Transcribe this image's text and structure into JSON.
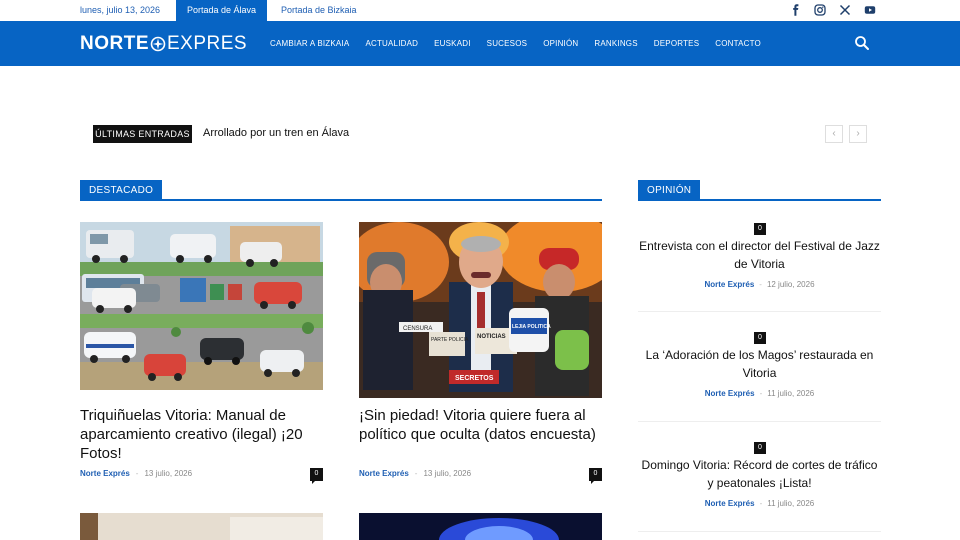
{
  "topbar": {
    "date": "lunes, julio 13, 2026",
    "tabs": [
      {
        "label": "Portada de Álava",
        "active": true
      },
      {
        "label": "Portada de Bizkaia",
        "active": false
      }
    ],
    "social_icons": [
      "facebook-icon",
      "instagram-icon",
      "x-icon",
      "youtube-icon"
    ]
  },
  "header": {
    "logo_bold": "NORTE",
    "logo_light": "EXPRES",
    "nav": [
      "CAMBIAR A BIZKAIA",
      "ACTUALIDAD",
      "EUSKADI",
      "SUCESOS",
      "OPINIÓN",
      "RANKINGS",
      "DEPORTES",
      "CONTACTO"
    ],
    "search_icon": "search-icon"
  },
  "ticker": {
    "label": "ÚLTIMAS ENTRADAS",
    "headline": "Arrollado por un tren en Álava",
    "prev": "‹",
    "next": "›"
  },
  "featured": {
    "heading": "DESTACADO",
    "articles": [
      {
        "title": "Triquiñuelas Vitoria: Manual de aparcamiento creativo (ilegal) ¡20 Fotos!",
        "author": "Norte Exprés",
        "sep": "-",
        "date": "13 julio, 2026",
        "comments": "0"
      },
      {
        "title": "¡Sin piedad! Vitoria quiere fuera al político que oculta (datos encuesta)",
        "author": "Norte Exprés",
        "sep": "-",
        "date": "13 julio, 2026",
        "comments": "0",
        "image_labels": [
          "CENSURA",
          "PARTE POLICIA",
          "NOTICIAS",
          "LEJIA POLITICA",
          "SECRETOS"
        ]
      }
    ]
  },
  "opinion": {
    "heading": "OPINIÓN",
    "items": [
      {
        "comments": "0",
        "title": "Entrevista con el director del Festival de Jazz de Vitoria",
        "author": "Norte Exprés",
        "sep": "-",
        "date": "12 julio, 2026"
      },
      {
        "comments": "0",
        "title": "La ‘Adoración de los Magos’ restaurada en Vitoria",
        "author": "Norte Exprés",
        "sep": "-",
        "date": "11 julio, 2026"
      },
      {
        "comments": "0",
        "title": "Domingo Vitoria: Récord de cortes de tráfico y peatonales ¡Lista!",
        "author": "Norte Exprés",
        "sep": "-",
        "date": "11 julio, 2026"
      }
    ]
  },
  "colors": {
    "brand": "#0764c4",
    "link": "#1f5fb3",
    "dark": "#111111"
  }
}
